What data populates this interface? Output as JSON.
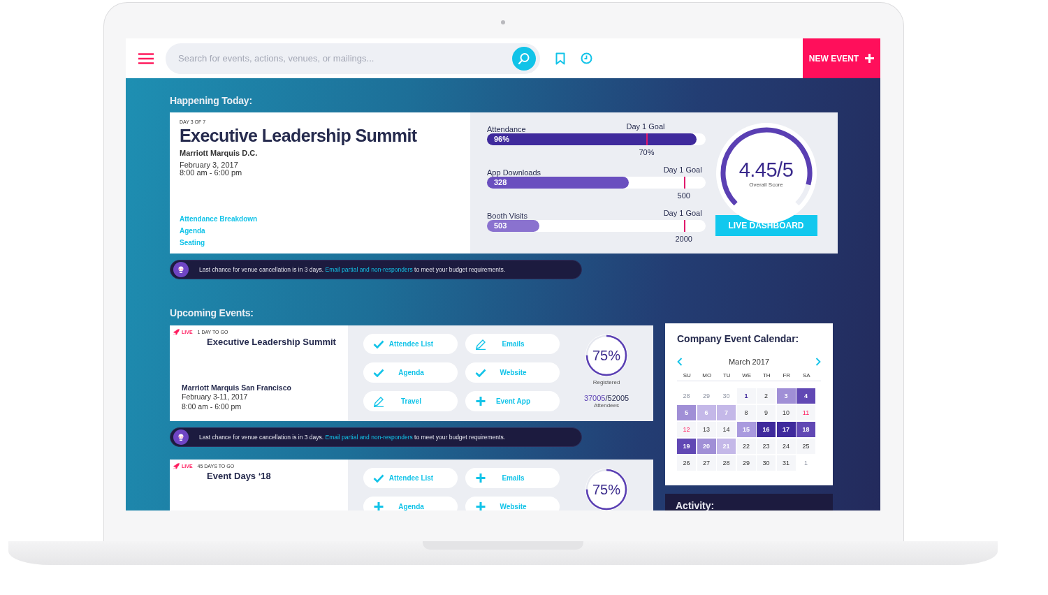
{
  "header": {
    "search": {
      "placeholder": "Search for events, actions, venues, or mailings..."
    },
    "new_event_button": "NEW EVENT"
  },
  "today": {
    "heading": "Happening Today:",
    "day_label": "DAY 3 OF 7",
    "title": "Executive Leadership Summit",
    "venue": "Marriott Marquis D.C.",
    "date": "February 3, 2017",
    "time": "8:00 am - 6:00 pm",
    "links": [
      "Attendance Breakdown",
      "Agenda",
      "Seating"
    ],
    "metrics": [
      {
        "label": "Attendance",
        "value": "96%",
        "level": 0.96,
        "color": "#3f2a9c",
        "goal": {
          "label": "Day 1 Goal",
          "value": "70%",
          "level": 0.73
        }
      },
      {
        "label": "App Downloads",
        "value": "328",
        "level": 0.65,
        "color": "#6a4fbf",
        "goal": {
          "label": "Day 1 Goal",
          "value": "500",
          "level": 0.9
        }
      },
      {
        "label": "Booth Visits",
        "value": "503",
        "level": 0.24,
        "color": "#8a72cf",
        "goal": {
          "label": "Day 1 Goal",
          "value": "2000",
          "level": 0.9
        }
      }
    ],
    "score": {
      "value": "4.45/5",
      "caption": "Overall Score"
    },
    "dashboard_button": "LIVE DASHBOARD",
    "notice": {
      "before": "Last chance for venue cancellation is in 3 days. ",
      "link": "Email partial and non-responders",
      "after": " to meet your budget requirements."
    }
  },
  "upcoming": {
    "heading": "Upcoming Events:",
    "items": [
      {
        "kind": "event",
        "status": "LIVE",
        "countdown": "1 DAY TO GO",
        "title": "Executive Leadership Summit",
        "venue": "Marriott Marquis San Francisco",
        "dates": "February 3-11, 2017",
        "time": "8:00 am - 6:00 pm",
        "actions": [
          {
            "label": "Attendee List",
            "kind": "check"
          },
          {
            "label": "Emails",
            "kind": "edit"
          },
          {
            "label": "Agenda",
            "kind": "check"
          },
          {
            "label": "Website",
            "kind": "check"
          },
          {
            "label": "Travel",
            "kind": "edit"
          },
          {
            "label": "Event App",
            "kind": "add"
          }
        ],
        "registered": {
          "value": "75%",
          "caption": "Registered"
        },
        "attendees": {
          "count": "37005",
          "total": "/52005",
          "caption": "Attendees"
        }
      },
      {
        "kind": "notice",
        "before": "Last chance for venue cancellation is in 3 days. ",
        "link": "Email partial and non-responders",
        "after": " to meet your budget requirements."
      },
      {
        "kind": "event",
        "status": "LIVE",
        "countdown": "45 DAYS TO GO",
        "title": "Event Days ‘18",
        "actions": [
          {
            "label": "Attendee List",
            "kind": "check"
          },
          {
            "label": "Emails",
            "kind": "add"
          },
          {
            "label": "Agenda",
            "kind": "add"
          },
          {
            "label": "Website",
            "kind": "add"
          }
        ],
        "registered": {
          "value": "75%"
        }
      }
    ]
  },
  "calendar": {
    "title": "Company Event Calendar:",
    "month": "March 2017",
    "weekdays": [
      "SU",
      "MO",
      "TU",
      "WE",
      "TH",
      "FR",
      "SA"
    ],
    "days": [
      {
        "label": "28",
        "kind": "other"
      },
      {
        "label": "29",
        "kind": "other"
      },
      {
        "label": "30",
        "kind": "other"
      },
      {
        "label": "1",
        "kind": "today"
      },
      {
        "label": "2",
        "kind": "day"
      },
      {
        "label": "3",
        "kind": "event",
        "color": "#a08fd6"
      },
      {
        "label": "4",
        "kind": "event",
        "color": "#6148b4"
      },
      {
        "label": "5",
        "kind": "event",
        "color": "#a08fd6"
      },
      {
        "label": "6",
        "kind": "event",
        "color": "#c4b8e8"
      },
      {
        "label": "7",
        "kind": "event",
        "color": "#c4b8e8"
      },
      {
        "label": "8",
        "kind": "day"
      },
      {
        "label": "9",
        "kind": "day"
      },
      {
        "label": "10",
        "kind": "day"
      },
      {
        "label": "11",
        "kind": "holiday"
      },
      {
        "label": "12",
        "kind": "holiday"
      },
      {
        "label": "13",
        "kind": "day"
      },
      {
        "label": "14",
        "kind": "day"
      },
      {
        "label": "15",
        "kind": "event",
        "color": "#a99ade"
      },
      {
        "label": "16",
        "kind": "event",
        "color": "#3f2a9c"
      },
      {
        "label": "17",
        "kind": "event",
        "color": "#3f2a9c"
      },
      {
        "label": "18",
        "kind": "event",
        "color": "#6148b4"
      },
      {
        "label": "19",
        "kind": "event",
        "color": "#6148b4"
      },
      {
        "label": "20",
        "kind": "event",
        "color": "#a08fd6"
      },
      {
        "label": "21",
        "kind": "event",
        "color": "#c4b8e8"
      },
      {
        "label": "22",
        "kind": "day"
      },
      {
        "label": "23",
        "kind": "day"
      },
      {
        "label": "24",
        "kind": "day"
      },
      {
        "label": "25",
        "kind": "day"
      },
      {
        "label": "26",
        "kind": "day"
      },
      {
        "label": "27",
        "kind": "day"
      },
      {
        "label": "28",
        "kind": "day"
      },
      {
        "label": "29",
        "kind": "day"
      },
      {
        "label": "30",
        "kind": "day"
      },
      {
        "label": "31",
        "kind": "day"
      },
      {
        "label": "1",
        "kind": "other"
      }
    ]
  },
  "activity": {
    "title": "Activity:"
  }
}
